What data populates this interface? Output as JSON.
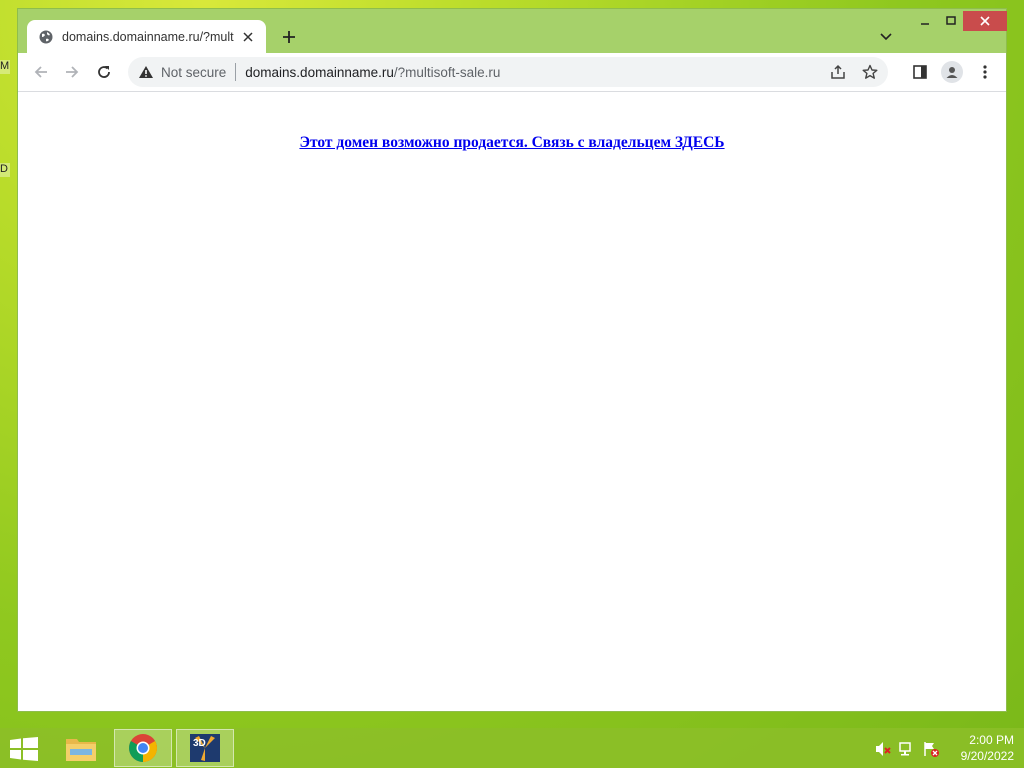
{
  "desktop": {
    "icon_labels": [
      "M",
      "D"
    ]
  },
  "browser": {
    "tab": {
      "title": "domains.domainname.ru/?multisoft-sale.ru"
    },
    "omnibox": {
      "security_label": "Not secure",
      "url_host": "domains.domainname.ru",
      "url_rest": "/?multisoft-sale.ru"
    }
  },
  "page": {
    "link_text": "Этот домен возможно продается. Связь с владельцем ЗДЕСЬ"
  },
  "taskbar": {
    "apps": [
      "file-explorer",
      "chrome",
      "3d-app"
    ],
    "clock_time": "2:00 PM",
    "clock_date": "9/20/2022"
  },
  "colors": {
    "desktop": "#9ccb2a",
    "link": "#0000ee",
    "close_button": "#c94c4c"
  }
}
